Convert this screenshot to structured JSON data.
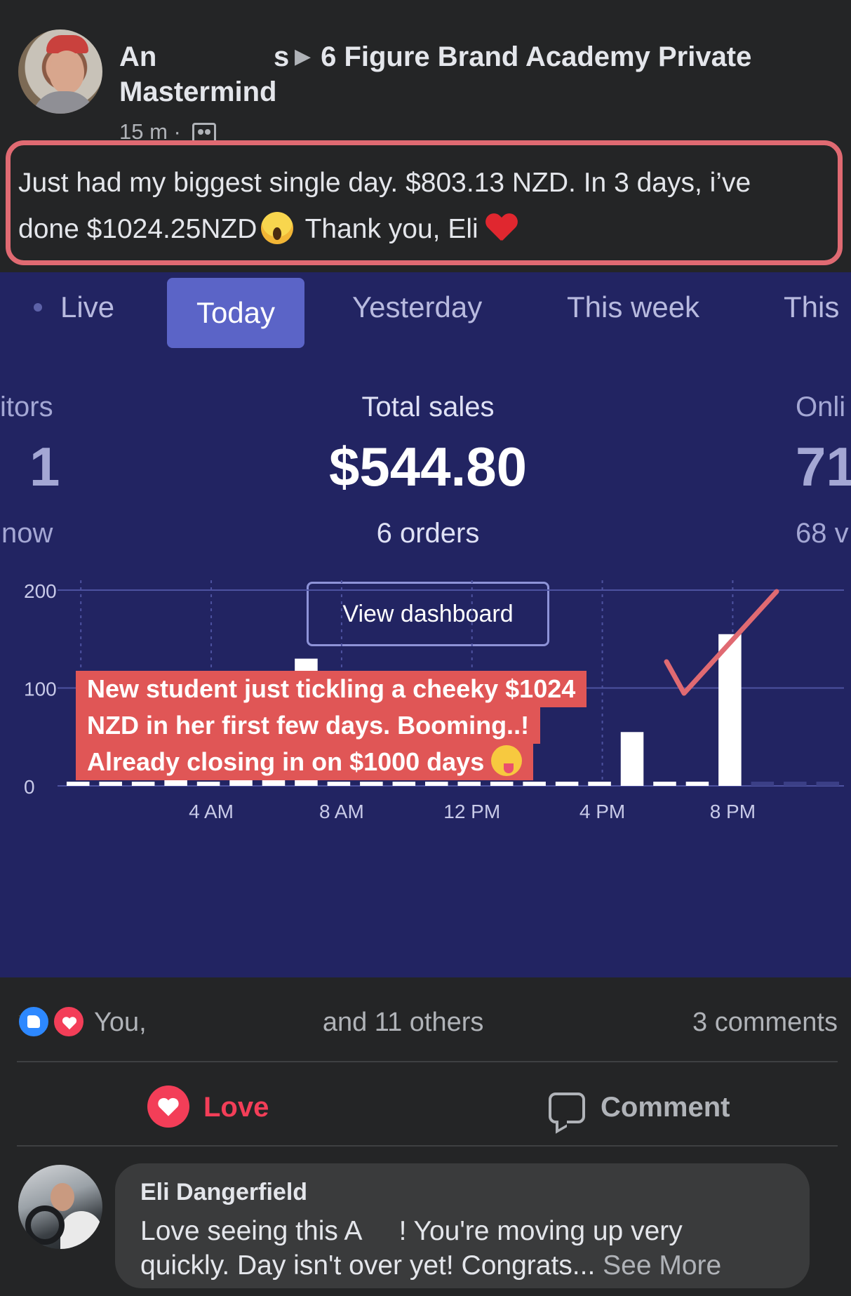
{
  "post": {
    "author_partial": "An",
    "author_trail": "s",
    "group_name": "6 Figure Brand Academy Private Mastermind",
    "time": "15 m ·",
    "text_line1": "Just had my biggest single day. $803.13 NZD. In 3 days, i’ve",
    "text_line2_a": "done $1024.25NZD",
    "text_line2_b": "Thank you, Eli",
    "icons": [
      "group-privacy-icon",
      "scream-emoji",
      "red-heart-emoji"
    ]
  },
  "dashboard": {
    "tabs": [
      {
        "label": "Live"
      },
      {
        "label": "Today"
      },
      {
        "label": "Yesterday"
      },
      {
        "label": "This week"
      },
      {
        "label": "This"
      }
    ],
    "active_tab": "Today",
    "left_stat": {
      "label": "itors",
      "value": "1",
      "sub": "now"
    },
    "center_stat": {
      "label": "Total sales",
      "value": "$544.80",
      "sub": "6 orders"
    },
    "right_stat": {
      "label": "Onli",
      "value": "71",
      "sub": "68 v"
    },
    "view_dashboard": "View dashboard",
    "callout": {
      "line1": "New student just tickling a cheeky $1024",
      "line2": "NZD in her first few days. Booming..!",
      "line3": "Already closing in on $1000 days"
    },
    "colors": {
      "background": "#222462",
      "active_tab": "#5b64c7",
      "callout": "#e05656",
      "annotation": "#e06a72"
    }
  },
  "chart_data": {
    "type": "bar",
    "categories": [
      "12 AM",
      "1 AM",
      "2 AM",
      "3 AM",
      "4 AM",
      "5 AM",
      "6 AM",
      "7 AM",
      "8 AM",
      "9 AM",
      "10 AM",
      "11 AM",
      "12 PM",
      "1 PM",
      "2 PM",
      "3 PM",
      "4 PM",
      "5 PM",
      "6 PM",
      "7 PM",
      "8 PM",
      "9 PM",
      "10 PM",
      "11 PM"
    ],
    "values": [
      0,
      0,
      0,
      47,
      0,
      59,
      59,
      130,
      0,
      0,
      0,
      0,
      0,
      0,
      0,
      0,
      0,
      55,
      0,
      0,
      155,
      0,
      0,
      0
    ],
    "future_hours": [
      "9 PM",
      "10 PM",
      "11 PM"
    ],
    "x_tick_labels": [
      "4 AM",
      "8 AM",
      "12 PM",
      "4 PM",
      "8 PM"
    ],
    "y_tick_labels": [
      "0",
      "100",
      "200"
    ],
    "ylim": [
      0,
      200
    ],
    "grid": true
  },
  "reactions": {
    "names_start": "You,",
    "names_end": "and 11 others",
    "comments": "3 comments"
  },
  "actions": {
    "love": "Love",
    "comment": "Comment"
  },
  "comment": {
    "name": "Eli Dangerfield",
    "line1_a": "Love seeing this A",
    "line1_b": "! You're moving up very",
    "line2": "quickly. Day isn't over yet! Congrats...",
    "see_more": "See More"
  }
}
